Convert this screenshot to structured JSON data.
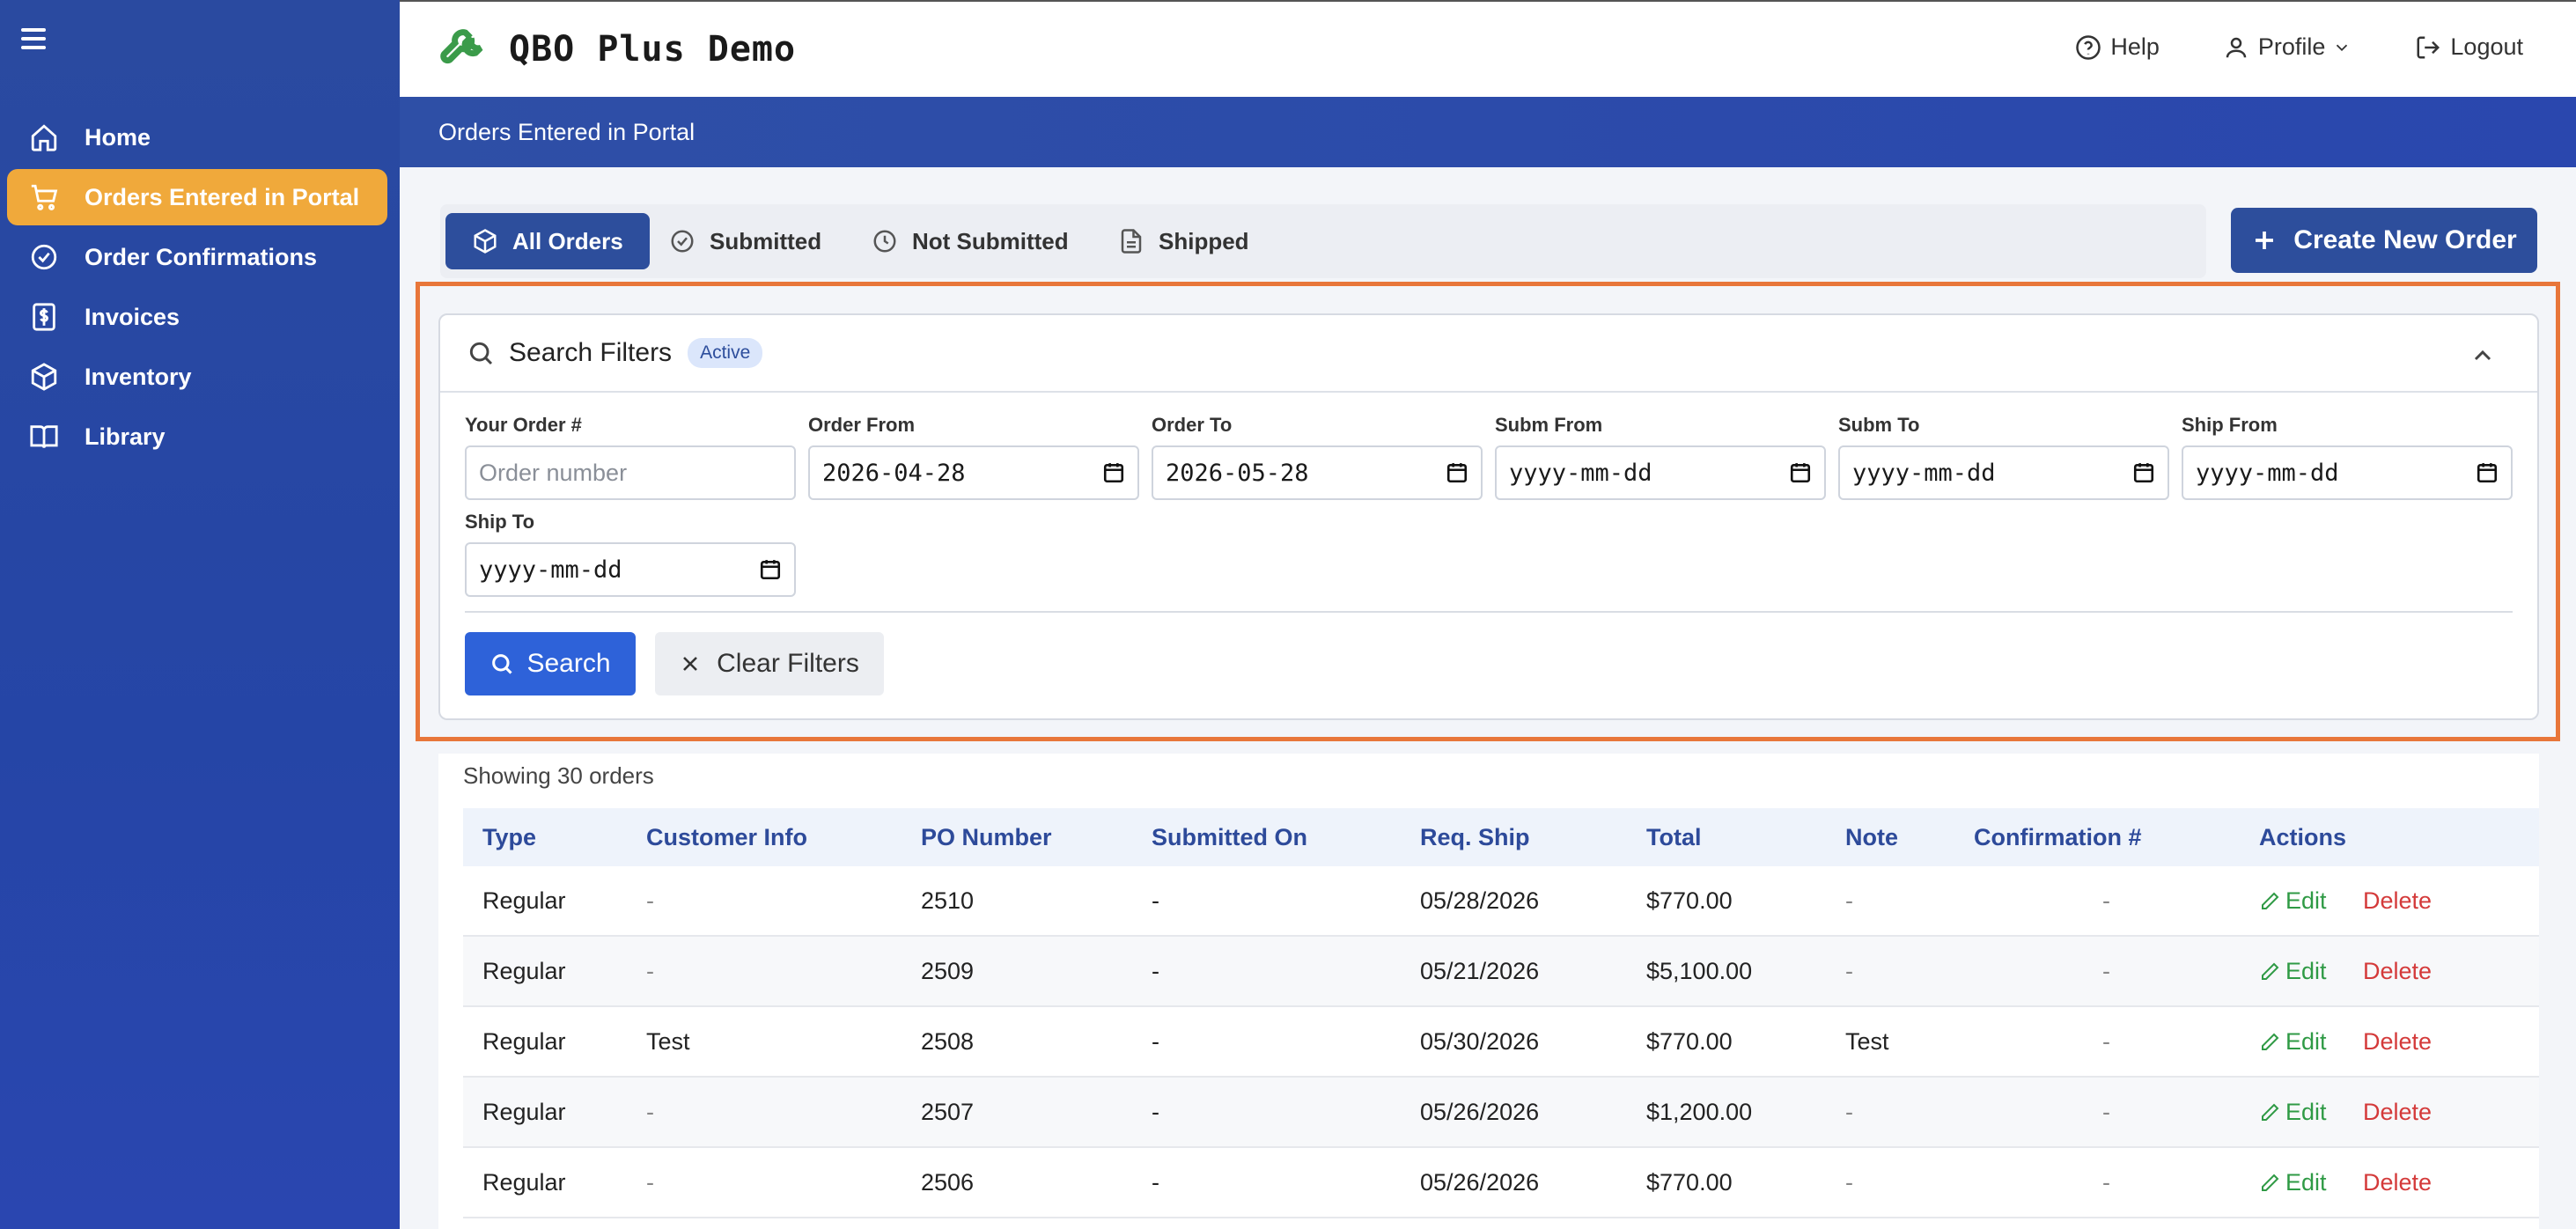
{
  "app": {
    "title": "QBO Plus Demo",
    "page_header": "Orders Entered in Portal"
  },
  "topnav": {
    "help": "Help",
    "profile": "Profile",
    "logout": "Logout"
  },
  "sidebar": {
    "items": [
      {
        "label": "Home",
        "icon": "home-icon"
      },
      {
        "label": "Orders Entered in Portal",
        "icon": "cart-icon",
        "active": true
      },
      {
        "label": "Order Confirmations",
        "icon": "check-circle-icon"
      },
      {
        "label": "Invoices",
        "icon": "dollar-icon"
      },
      {
        "label": "Inventory",
        "icon": "box-icon"
      },
      {
        "label": "Library",
        "icon": "book-icon"
      }
    ]
  },
  "tabs": [
    {
      "label": "All Orders",
      "icon": "box-icon",
      "active": true
    },
    {
      "label": "Submitted",
      "icon": "check-circle-icon"
    },
    {
      "label": "Not Submitted",
      "icon": "clock-icon"
    },
    {
      "label": "Shipped",
      "icon": "document-icon"
    }
  ],
  "create_button": "Create New Order",
  "filters": {
    "title": "Search Filters",
    "badge": "Active",
    "fields": {
      "order_num": {
        "label": "Your Order #",
        "placeholder": "Order number"
      },
      "order_from": {
        "label": "Order From",
        "value": "2026-04-28"
      },
      "order_to": {
        "label": "Order To",
        "value": "2026-05-28"
      },
      "subm_from": {
        "label": "Subm From",
        "value": "yyyy-mm-dd"
      },
      "subm_to": {
        "label": "Subm To",
        "value": "yyyy-mm-dd"
      },
      "ship_from": {
        "label": "Ship From",
        "value": "yyyy-mm-dd"
      },
      "ship_to": {
        "label": "Ship To",
        "value": "yyyy-mm-dd"
      }
    },
    "search_label": "Search",
    "clear_label": "Clear Filters"
  },
  "results": {
    "count_text": "Showing 30 orders",
    "columns": [
      "Type",
      "Customer Info",
      "PO Number",
      "Submitted On",
      "Req. Ship",
      "Total",
      "Note",
      "Confirmation #",
      "Actions"
    ],
    "edit_label": "Edit",
    "delete_label": "Delete",
    "rows": [
      {
        "type": "Regular",
        "customer": "-",
        "po": "2510",
        "submitted": "-",
        "req_ship": "05/28/2026",
        "total": "$770.00",
        "note": "-",
        "confirmation": "-"
      },
      {
        "type": "Regular",
        "customer": "-",
        "po": "2509",
        "submitted": "-",
        "req_ship": "05/21/2026",
        "total": "$5,100.00",
        "note": "-",
        "confirmation": "-"
      },
      {
        "type": "Regular",
        "customer": "Test",
        "po": "2508",
        "submitted": "-",
        "req_ship": "05/30/2026",
        "total": "$770.00",
        "note": "Test",
        "confirmation": "-"
      },
      {
        "type": "Regular",
        "customer": "-",
        "po": "2507",
        "submitted": "-",
        "req_ship": "05/26/2026",
        "total": "$1,200.00",
        "note": "-",
        "confirmation": "-"
      },
      {
        "type": "Regular",
        "customer": "-",
        "po": "2506",
        "submitted": "-",
        "req_ship": "05/26/2026",
        "total": "$770.00",
        "note": "-",
        "confirmation": "-"
      }
    ]
  }
}
